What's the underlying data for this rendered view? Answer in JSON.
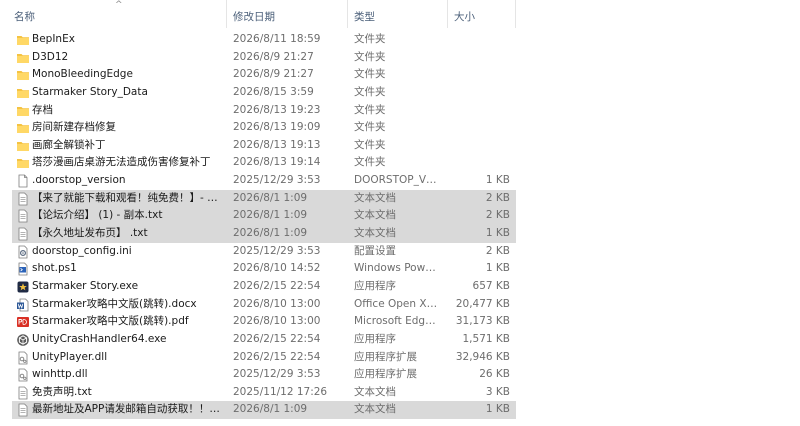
{
  "columns": {
    "name": "名称",
    "date": "修改日期",
    "type": "类型",
    "size": "大小"
  },
  "sort_indicator": "^",
  "files": [
    {
      "name": "BepInEx",
      "date": "2026/8/11 18:59",
      "type": "文件夹",
      "size": "",
      "icon": "folder-icon",
      "selected": false
    },
    {
      "name": "D3D12",
      "date": "2026/8/9 21:27",
      "type": "文件夹",
      "size": "",
      "icon": "folder-icon",
      "selected": false
    },
    {
      "name": "MonoBleedingEdge",
      "date": "2026/8/9 21:27",
      "type": "文件夹",
      "size": "",
      "icon": "folder-icon",
      "selected": false
    },
    {
      "name": "Starmaker Story_Data",
      "date": "2026/8/15 3:59",
      "type": "文件夹",
      "size": "",
      "icon": "folder-icon",
      "selected": false
    },
    {
      "name": "存档",
      "date": "2026/8/13 19:23",
      "type": "文件夹",
      "size": "",
      "icon": "folder-icon",
      "selected": false
    },
    {
      "name": "房间新建存档修复",
      "date": "2026/8/13 19:09",
      "type": "文件夹",
      "size": "",
      "icon": "folder-icon",
      "selected": false
    },
    {
      "name": "画廊全解锁补丁",
      "date": "2026/8/13 19:13",
      "type": "文件夹",
      "size": "",
      "icon": "folder-icon",
      "selected": false
    },
    {
      "name": "塔莎漫画店桌游无法造成伤害修复补丁",
      "date": "2026/8/13 19:14",
      "type": "文件夹",
      "size": "",
      "icon": "folder-icon",
      "selected": false
    },
    {
      "name": ".doorstop_version",
      "date": "2025/12/29 3:53",
      "type": "DOORSTOP_VER...",
      "size": "1 KB",
      "icon": "blank-file-icon",
      "selected": false
    },
    {
      "name": "【来了就能下载和观看！纯免费！】- 副...",
      "date": "2026/8/1 1:09",
      "type": "文本文档",
      "size": "2 KB",
      "icon": "text-file-icon",
      "selected": true
    },
    {
      "name": "【论坛介绍】 (1) - 副本.txt",
      "date": "2026/8/1 1:09",
      "type": "文本文档",
      "size": "2 KB",
      "icon": "text-file-icon",
      "selected": true
    },
    {
      "name": "【永久地址发布页】 .txt",
      "date": "2026/8/1 1:09",
      "type": "文本文档",
      "size": "1 KB",
      "icon": "text-file-icon",
      "selected": true
    },
    {
      "name": "doorstop_config.ini",
      "date": "2025/12/29 3:53",
      "type": "配置设置",
      "size": "2 KB",
      "icon": "config-file-icon",
      "selected": false
    },
    {
      "name": "shot.ps1",
      "date": "2026/8/10 14:52",
      "type": "Windows Power...",
      "size": "1 KB",
      "icon": "powershell-file-icon",
      "selected": false
    },
    {
      "name": "Starmaker Story.exe",
      "date": "2026/2/15 22:54",
      "type": "应用程序",
      "size": "657 KB",
      "icon": "app-exe-icon",
      "selected": false
    },
    {
      "name": "Starmaker攻略中文版(跳转).docx",
      "date": "2026/8/10 13:00",
      "type": "Office Open XM...",
      "size": "20,477 KB",
      "icon": "docx-file-icon",
      "selected": false
    },
    {
      "name": "Starmaker攻略中文版(跳转).pdf",
      "date": "2026/8/10 13:00",
      "type": "Microsoft Edge ...",
      "size": "31,173 KB",
      "icon": "pdf-file-icon",
      "selected": false
    },
    {
      "name": "UnityCrashHandler64.exe",
      "date": "2026/2/15 22:54",
      "type": "应用程序",
      "size": "1,571 KB",
      "icon": "unity-exe-icon",
      "selected": false
    },
    {
      "name": "UnityPlayer.dll",
      "date": "2026/2/15 22:54",
      "type": "应用程序扩展",
      "size": "32,946 KB",
      "icon": "dll-file-icon",
      "selected": false
    },
    {
      "name": "winhttp.dll",
      "date": "2025/12/29 3:53",
      "type": "应用程序扩展",
      "size": "26 KB",
      "icon": "dll-file-icon",
      "selected": false
    },
    {
      "name": "免责声明.txt",
      "date": "2025/11/12 17:26",
      "type": "文本文档",
      "size": "3 KB",
      "icon": "text-file-icon",
      "selected": false
    },
    {
      "name": "最新地址及APP请发邮箱自动获取！！！...",
      "date": "2026/8/1 1:09",
      "type": "文本文档",
      "size": "1 KB",
      "icon": "text-file-icon",
      "selected": true
    }
  ]
}
